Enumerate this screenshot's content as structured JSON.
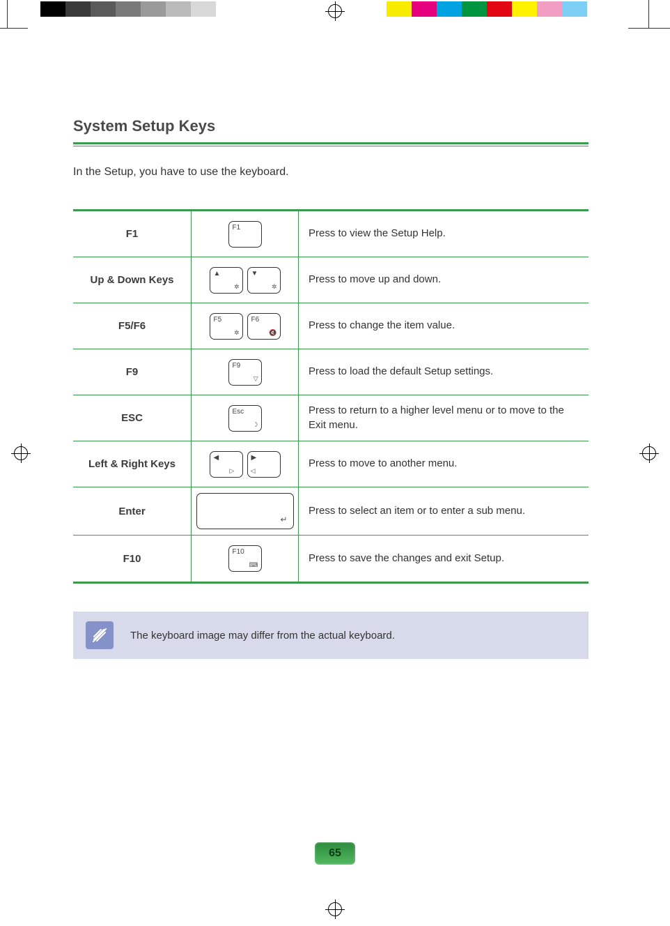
{
  "section_title": "System Setup Keys",
  "intro": "In the Setup, you have to use the keyboard.",
  "rows": [
    {
      "name": "F1",
      "keys": [
        "F1"
      ],
      "desc": "Press to view the Setup Help."
    },
    {
      "name": "Up & Down Keys",
      "keys": [
        "▲",
        "▼"
      ],
      "desc": "Press to move up and down."
    },
    {
      "name": "F5/F6",
      "keys": [
        "F5",
        "F6"
      ],
      "desc": "Press to change the item value."
    },
    {
      "name": "F9",
      "keys": [
        "F9"
      ],
      "desc": "Press to load the default Setup settings."
    },
    {
      "name": "ESC",
      "keys": [
        "Esc"
      ],
      "desc": "Press to return to a higher level menu or to move to the Exit menu."
    },
    {
      "name": "Left & Right Keys",
      "keys": [
        "◀",
        "▶"
      ],
      "desc": "Press to move to another menu."
    },
    {
      "name": "Enter",
      "keys": [
        "↵"
      ],
      "wide": true,
      "desc": "Press to select an item or to enter a sub menu."
    },
    {
      "name": "F10",
      "keys": [
        "F10"
      ],
      "desc": "Press to save the changes and exit Setup."
    }
  ],
  "note": "The keyboard image may differ from the actual keyboard.",
  "page_number": "65",
  "color_bars": {
    "left": [
      "#000000",
      "#3a3a3a",
      "#5a5a5a",
      "#7a7a7a",
      "#9a9a9a",
      "#bababa",
      "#d8d8d8",
      "#ffffff"
    ],
    "right": [
      "#f7ec00",
      "#e6007e",
      "#00a3e2",
      "#009640",
      "#e30613",
      "#fff200",
      "#f29ec4",
      "#7ecff5",
      "#ffffff"
    ]
  }
}
